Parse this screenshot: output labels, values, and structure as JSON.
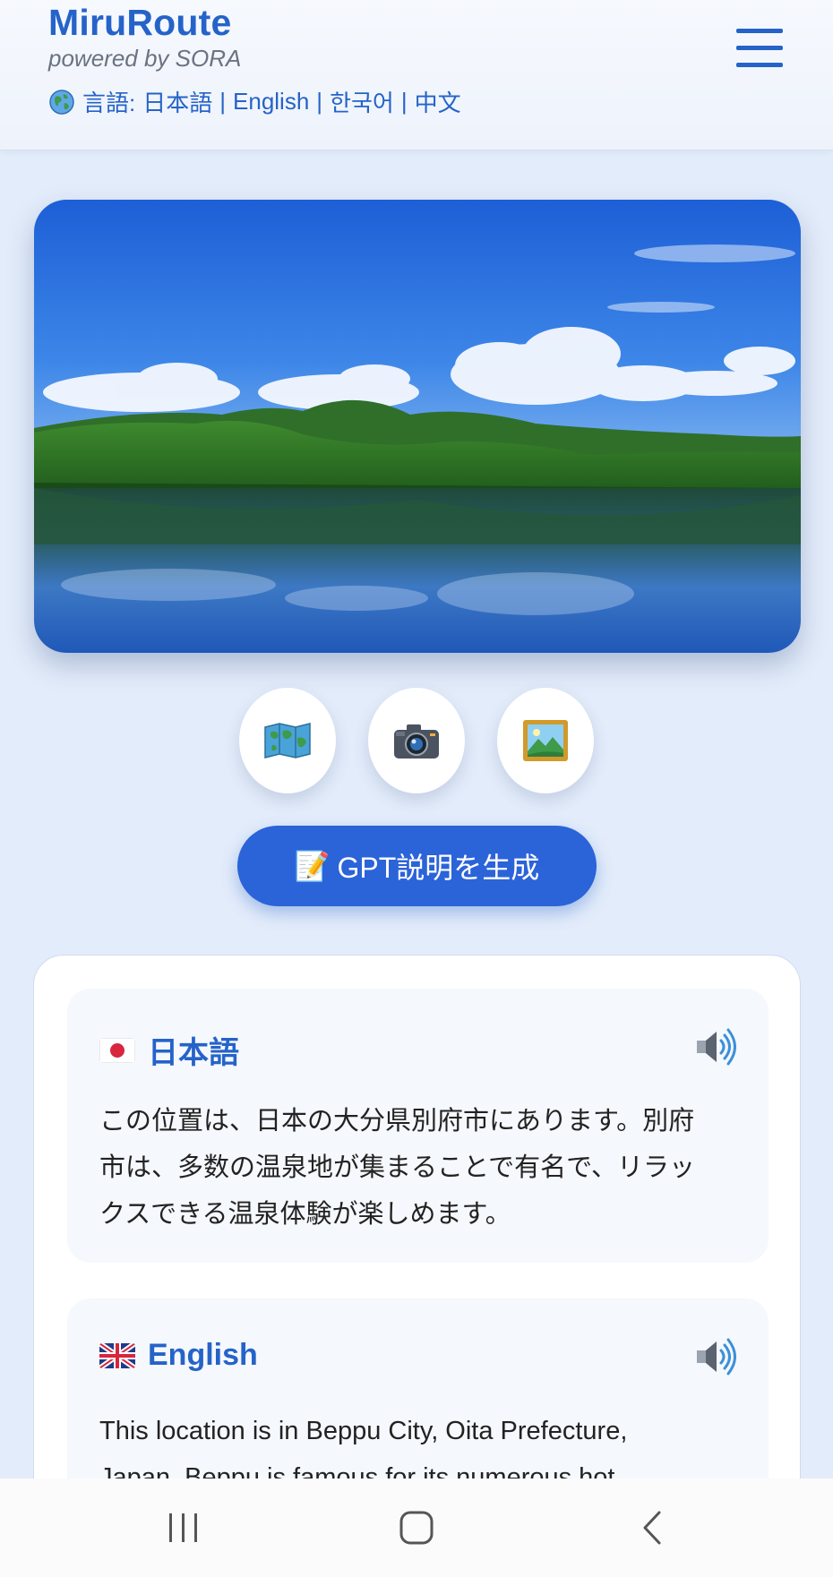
{
  "header": {
    "title": "MiruRoute",
    "subtitle": "powered by SORA",
    "language_prefix": "言語:",
    "languages": [
      "日本語",
      "English",
      "한국어",
      "中文"
    ],
    "menu_icon": "hamburger-menu-icon"
  },
  "hero": {
    "description": "Landscape photo of green mountains reflected in a calm lake under blue sky"
  },
  "actions": [
    {
      "icon": "map-icon"
    },
    {
      "icon": "camera-icon"
    },
    {
      "icon": "picture-icon"
    }
  ],
  "gpt_button": {
    "emoji": "📝",
    "label": "GPT説明を生成"
  },
  "descriptions": [
    {
      "flag": "japan-flag-icon",
      "title": "日本語",
      "lines": [
        "この位置は、日本の大分県別府市にあります。別府",
        "市は、多数の温泉地が集まることで有名で、リラッ",
        "クスできる温泉体験が楽しめます。"
      ]
    },
    {
      "flag": "uk-flag-icon",
      "title": "English",
      "lines": [
        "This location is in Beppu City, Oita Prefecture,",
        "Japan. Beppu is famous for its numerous hot"
      ]
    }
  ],
  "colors": {
    "accent": "#2563c9",
    "background": "#e3ecfa",
    "button": "#2b63d9"
  }
}
